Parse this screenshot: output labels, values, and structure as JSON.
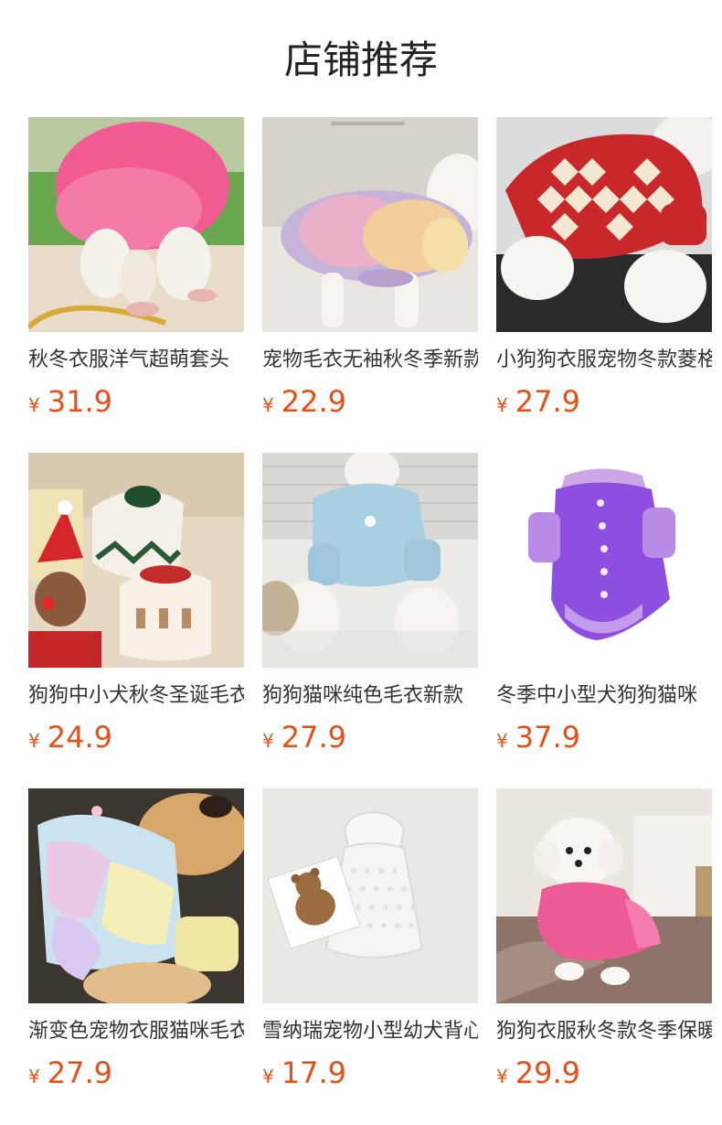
{
  "header": {
    "title": "店铺推荐"
  },
  "currency": "¥",
  "products": [
    {
      "name": "秋冬衣服洋气超萌套头",
      "price": "31.9",
      "image": "pink-fluffy-sweater-dog-photo"
    },
    {
      "name": "宠物毛衣无袖秋冬季新款",
      "price": "22.9",
      "image": "rainbow-knit-vest-dog-photo"
    },
    {
      "name": "小狗狗衣服宠物冬款菱格",
      "price": "27.9",
      "image": "red-argyle-sweater-dog-photo"
    },
    {
      "name": "狗狗中小犬秋冬圣诞毛衣",
      "price": "24.9",
      "image": "christmas-reindeer-sweaters-photo"
    },
    {
      "name": "狗狗猫咪纯色毛衣新款",
      "price": "27.9",
      "image": "blue-cardigan-dog-photo"
    },
    {
      "name": "冬季中小型犬狗狗猫咪",
      "price": "37.9",
      "image": "purple-fluffy-sweater-photo"
    },
    {
      "name": "渐变色宠物衣服猫咪毛衣",
      "price": "27.9",
      "image": "pastel-patchwork-sweater-dog-photo"
    },
    {
      "name": "雪纳瑞宠物小型幼犬背心",
      "price": "17.9",
      "image": "white-knit-vest-teddy-card-photo"
    },
    {
      "name": "狗狗衣服秋冬款冬季保暖",
      "price": "29.9",
      "image": "pink-sweater-white-poodle-photo"
    }
  ]
}
